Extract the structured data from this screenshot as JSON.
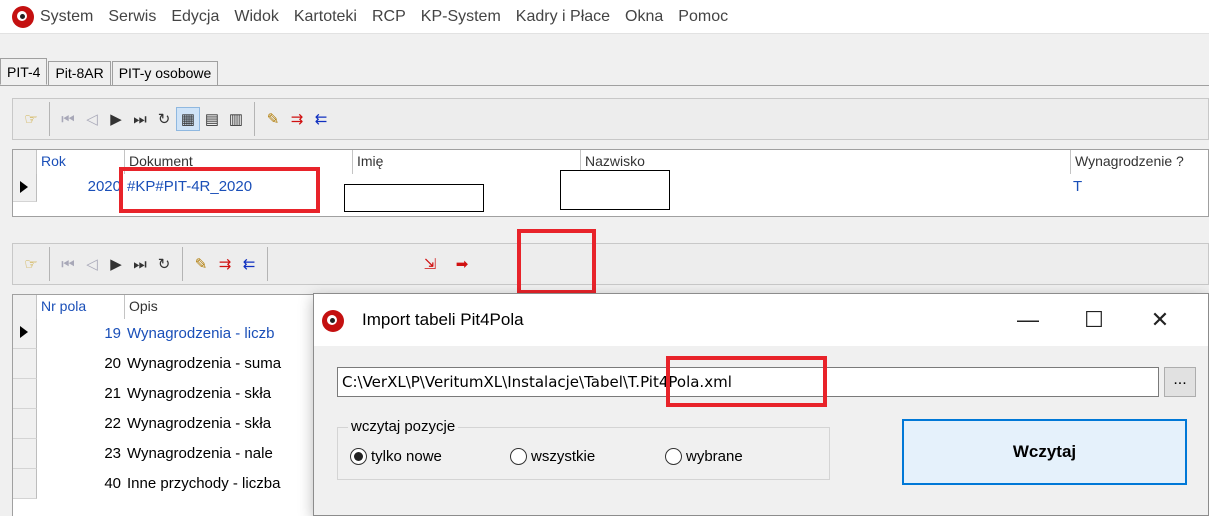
{
  "menu": [
    "System",
    "Serwis",
    "Edycja",
    "Widok",
    "Kartoteki",
    "RCP",
    "KP-System",
    "Kadry i Płace",
    "Okna",
    "Pomoc"
  ],
  "tabs": [
    "PIT-4",
    "Pit-8AR",
    "PIT-y osobowe"
  ],
  "top_grid": {
    "headers": {
      "rok": "Rok",
      "dokument": "Dokument",
      "imie": "Imię",
      "nazwisko": "Nazwisko",
      "wynagrodzenie": "Wynagrodzenie ?"
    },
    "row": {
      "rok": "2020",
      "dokument": "#KP#PIT-4R_2020",
      "imie": "",
      "nazwisko": "",
      "wynagrodzenie": "T"
    }
  },
  "bottom_grid": {
    "headers": {
      "nr_pola": "Nr pola",
      "opis": "Opis"
    },
    "rows": [
      {
        "nr": "19",
        "opis": "Wynagrodzenia - liczb"
      },
      {
        "nr": "20",
        "opis": "Wynagrodzenia - suma"
      },
      {
        "nr": "21",
        "opis": "Wynagrodzenia - skła"
      },
      {
        "nr": "22",
        "opis": "Wynagrodzenia - skła"
      },
      {
        "nr": "23",
        "opis": "Wynagrodzenia - nale"
      },
      {
        "nr": "40",
        "opis": "Inne przychody - liczba"
      }
    ]
  },
  "dialog": {
    "title": "Import tabeli Pit4Pola",
    "path_value": "C:\\VerXL\\P\\VeritumXL\\Instalacje\\Tabele\\T.Pit4Pola.xml",
    "path_prefix": "C:\\VerXL\\P\\VeritumXL\\Instalacje\\Tabel",
    "path_file": "\\T.Pit4Pola.xml",
    "browse_label": "...",
    "group_label": "wczytaj pozycje",
    "radios": [
      "tylko nowe",
      "wszystkie",
      "wybrane"
    ],
    "selected_radio": "tylko nowe",
    "load_button": "Wczytaj",
    "minimize": "—",
    "maximize": "☐",
    "close": "✕"
  },
  "colors": {
    "highlight": "#e8232a",
    "link_blue": "#1a4fb8",
    "primary_button_border": "#0078d7"
  },
  "icons": [
    "app-logo-icon",
    "pointer-hand-icon",
    "first-record-icon",
    "prev-record-icon",
    "next-record-icon",
    "last-record-icon",
    "refresh-icon",
    "grid-view-icon",
    "form-view-icon",
    "list-view-icon",
    "edit-icon",
    "insert-row-icon",
    "remove-row-icon",
    "import-icon",
    "export-icon"
  ]
}
